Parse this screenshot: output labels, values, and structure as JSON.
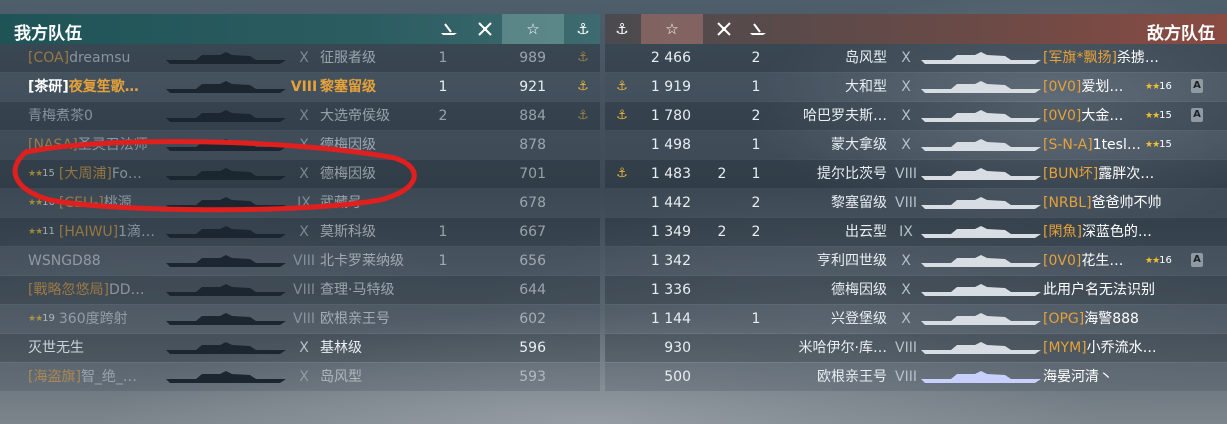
{
  "left": {
    "title": "我方队伍",
    "header_icons": [
      "destroyer-kills-icon",
      "aircraft-kills-icon",
      "xp-star-icon",
      "anchor-icon"
    ],
    "rows": [
      {
        "clan": "[COA]",
        "name": "dreamsu",
        "tier": "X",
        "ship": "征服者级",
        "kills": "1",
        "planes": "",
        "xp": "989",
        "anchor": "⚓",
        "rank": "",
        "dim": true
      },
      {
        "clan": "[茶研]",
        "name": "夜复笙歌…",
        "tier": "VIII",
        "ship": "黎塞留级",
        "kills": "1",
        "planes": "",
        "xp": "921",
        "anchor": "⚓",
        "rank": "",
        "me": true
      },
      {
        "clan": "",
        "name": "青梅煮茶0",
        "tier": "X",
        "ship": "大选帝侯级",
        "kills": "2",
        "planes": "",
        "xp": "884",
        "anchor": "⚓",
        "rank": "",
        "dim": true
      },
      {
        "clan": "[NASA]",
        "name": "圣灵召法师",
        "tier": "X",
        "ship": "德梅因级",
        "kills": "",
        "planes": "",
        "xp": "878",
        "anchor": "",
        "rank": "",
        "dim": true
      },
      {
        "clan": "[大周浦]",
        "name": "Fo…",
        "tier": "X",
        "ship": "德梅因级",
        "kills": "",
        "planes": "",
        "xp": "701",
        "anchor": "",
        "rank": "15",
        "dim": true
      },
      {
        "clan": "[CEU-]",
        "name": "桃源",
        "tier": "IX",
        "ship": "武藏号",
        "kills": "",
        "planes": "",
        "xp": "678",
        "anchor": "",
        "rank": "16",
        "dim": true
      },
      {
        "clan": "[HAIWU]",
        "name": "1滴…",
        "tier": "X",
        "ship": "莫斯科级",
        "kills": "1",
        "planes": "",
        "xp": "667",
        "anchor": "",
        "rank": "11",
        "dim": true
      },
      {
        "clan": "",
        "name": "WSNGD88",
        "tier": "VIII",
        "ship": "北卡罗莱纳级",
        "kills": "1",
        "planes": "",
        "xp": "656",
        "anchor": "",
        "rank": "",
        "dim": true
      },
      {
        "clan": "[戰略忽悠局]",
        "name": "DD…",
        "tier": "VIII",
        "ship": "查理·马特级",
        "kills": "",
        "planes": "",
        "xp": "644",
        "anchor": "",
        "rank": "",
        "dim": true
      },
      {
        "clan": "",
        "name": "360度跨射",
        "tier": "VIII",
        "ship": "欧根亲王号",
        "kills": "",
        "planes": "",
        "xp": "602",
        "anchor": "",
        "rank": "19",
        "dim": true
      },
      {
        "clan": "",
        "name": "灭世无生",
        "tier": "X",
        "ship": "基林级",
        "kills": "",
        "planes": "",
        "xp": "596",
        "anchor": "",
        "rank": "",
        "dim": false
      },
      {
        "clan": "[海盗旗]",
        "name": "智_绝_…",
        "tier": "X",
        "ship": "岛风型",
        "kills": "",
        "planes": "",
        "xp": "593",
        "anchor": "",
        "rank": "",
        "dim": true
      }
    ]
  },
  "right": {
    "title": "敌方队伍",
    "header_icons": [
      "anchor-icon",
      "xp-star-icon",
      "aircraft-kills-icon",
      "destroyer-kills-icon"
    ],
    "rows": [
      {
        "anchor": "",
        "xp": "2 466",
        "planes": "",
        "kills": "2",
        "ship": "岛风型",
        "tier": "X",
        "clan": "[军旗*飘扬]",
        "name": "杀掳…",
        "rank": "",
        "badge": ""
      },
      {
        "anchor": "⚓",
        "xp": "1 919",
        "planes": "",
        "kills": "1",
        "ship": "大和型",
        "tier": "X",
        "clan": "[0V0]",
        "name": "爱划…",
        "rank": "16",
        "badge": "A"
      },
      {
        "anchor": "⚓",
        "xp": "1 780",
        "planes": "",
        "kills": "2",
        "ship": "哈巴罗夫斯…",
        "tier": "X",
        "clan": "[0V0]",
        "name": "大金…",
        "rank": "15",
        "badge": "A"
      },
      {
        "anchor": "",
        "xp": "1 498",
        "planes": "",
        "kills": "1",
        "ship": "蒙大拿级",
        "tier": "X",
        "clan": "[S-N-A]",
        "name": "1tesl…",
        "rank": "15",
        "badge": ""
      },
      {
        "anchor": "⚓",
        "xp": "1 483",
        "planes": "2",
        "kills": "1",
        "ship": "提尔比茨号",
        "tier": "VIII",
        "clan": "[BUN坏]",
        "name": "露胖次…",
        "rank": "",
        "badge": ""
      },
      {
        "anchor": "",
        "xp": "1 442",
        "planes": "",
        "kills": "2",
        "ship": "黎塞留级",
        "tier": "VIII",
        "clan": "[NRBL]",
        "name": "爸爸帅不帅",
        "rank": "",
        "badge": ""
      },
      {
        "anchor": "",
        "xp": "1 349",
        "planes": "2",
        "kills": "2",
        "ship": "出云型",
        "tier": "IX",
        "clan": "[閑魚]",
        "name": "深蓝色的…",
        "rank": "",
        "badge": ""
      },
      {
        "anchor": "",
        "xp": "1 342",
        "planes": "",
        "kills": "",
        "ship": "亨利四世级",
        "tier": "X",
        "clan": "[0V0]",
        "name": "花生…",
        "rank": "16",
        "badge": "A"
      },
      {
        "anchor": "",
        "xp": "1 336",
        "planes": "",
        "kills": "",
        "ship": "德梅因级",
        "tier": "X",
        "clan": "",
        "name": "此用户名无法识别",
        "rank": "",
        "badge": ""
      },
      {
        "anchor": "",
        "xp": "1 144",
        "planes": "",
        "kills": "1",
        "ship": "兴登堡级",
        "tier": "X",
        "clan": "[OPG]",
        "name": "海警888",
        "rank": "",
        "badge": ""
      },
      {
        "anchor": "",
        "xp": "930",
        "planes": "",
        "kills": "",
        "ship": "米哈伊尔·库…",
        "tier": "VIII",
        "clan": "[MYM]",
        "name": "小乔流水…",
        "rank": "",
        "badge": ""
      },
      {
        "anchor": "",
        "xp": "500",
        "planes": "",
        "kills": "",
        "ship": "欧根亲王号",
        "tier": "VIII",
        "clan": "",
        "name": "海晏河清丶",
        "rank": "",
        "badge": ""
      }
    ]
  },
  "colors": {
    "ally_header": "#2b5c60",
    "enemy_header": "#8a4b42",
    "clan": "#e5a13a",
    "rank_star": "#f0c030",
    "highlight_circle": "#e0201e"
  }
}
